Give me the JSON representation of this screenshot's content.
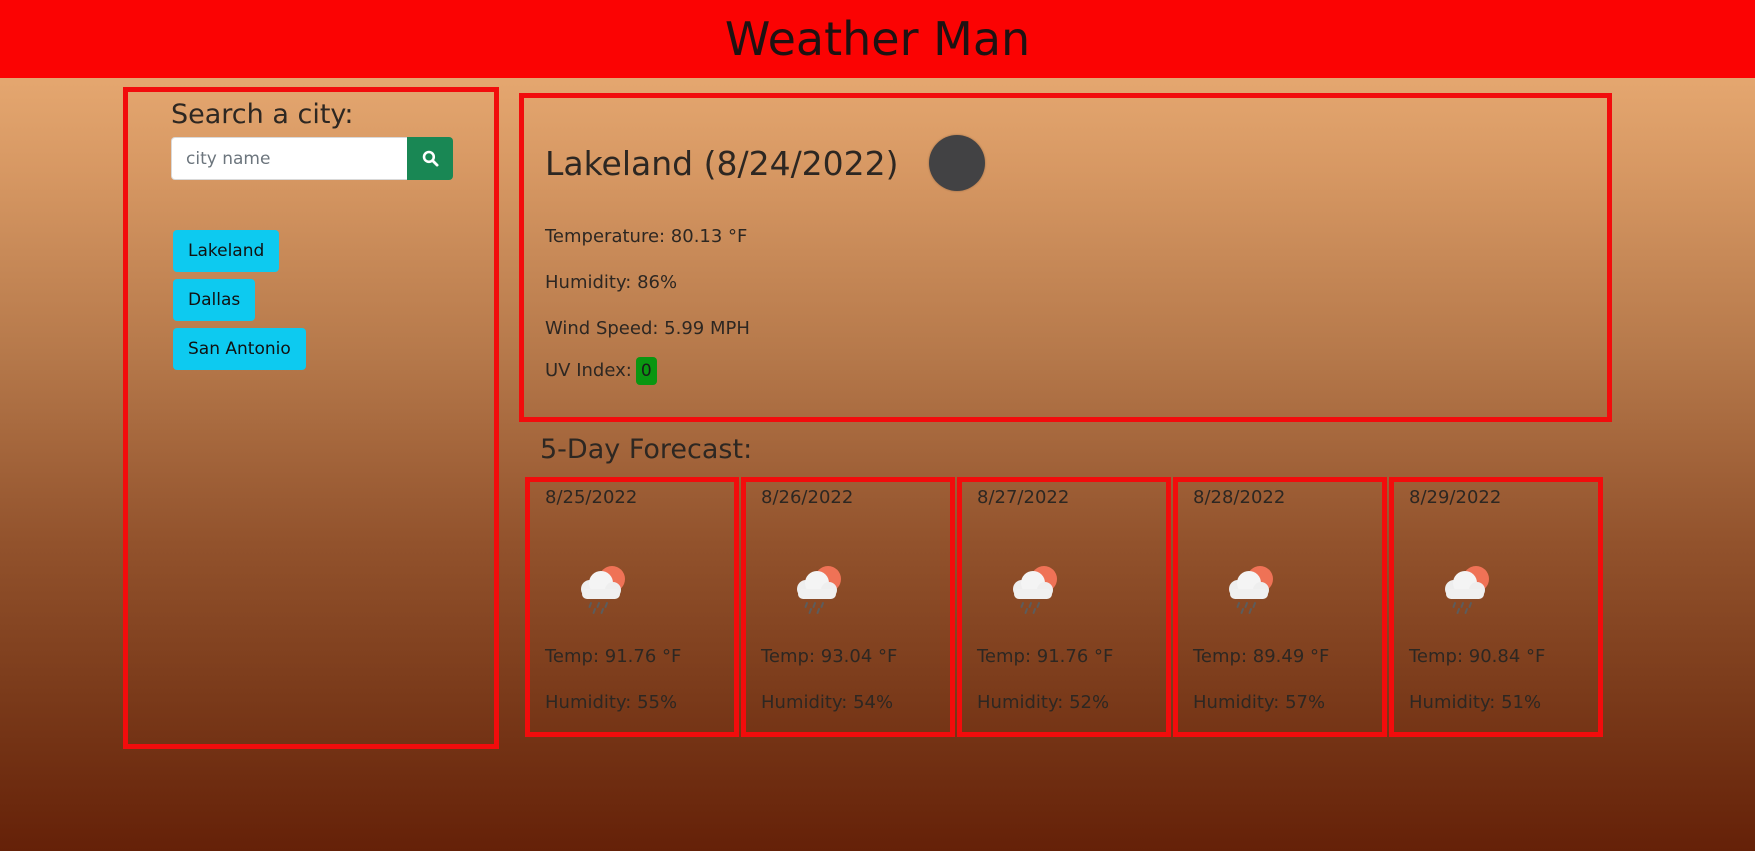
{
  "header": {
    "title": "Weather Man"
  },
  "search": {
    "label": "Search a city:",
    "placeholder": "city name",
    "button_icon": "search-icon"
  },
  "history": [
    {
      "label": "Lakeland"
    },
    {
      "label": "Dallas"
    },
    {
      "label": "San Antonio"
    }
  ],
  "current": {
    "title": "Lakeland (8/24/2022)",
    "icon": "night-icon",
    "temperature": "Temperature: 80.13 °F",
    "humidity": "Humidity: 86%",
    "wind": "Wind Speed: 5.99 MPH",
    "uv_label": "UV Index:",
    "uv_value": "0",
    "uv_color": "#0a9611"
  },
  "forecast": {
    "heading": "5-Day Forecast:",
    "days": [
      {
        "date": "8/25/2022",
        "icon": "rain-cloud-sun-icon",
        "temp": "Temp: 91.76 °F",
        "humidity": "Humidity: 55%"
      },
      {
        "date": "8/26/2022",
        "icon": "rain-cloud-sun-icon",
        "temp": "Temp: 93.04 °F",
        "humidity": "Humidity: 54%"
      },
      {
        "date": "8/27/2022",
        "icon": "rain-cloud-sun-icon",
        "temp": "Temp: 91.76 °F",
        "humidity": "Humidity: 52%"
      },
      {
        "date": "8/28/2022",
        "icon": "rain-cloud-sun-icon",
        "temp": "Temp: 89.49 °F",
        "humidity": "Humidity: 57%"
      },
      {
        "date": "8/29/2022",
        "icon": "rain-cloud-sun-icon",
        "temp": "Temp: 90.84 °F",
        "humidity": "Humidity: 51%"
      }
    ]
  },
  "colors": {
    "header_bg": "#fb0303",
    "border": "#f20c0c",
    "search_button": "#198754",
    "history_button": "#0dcaf0"
  }
}
